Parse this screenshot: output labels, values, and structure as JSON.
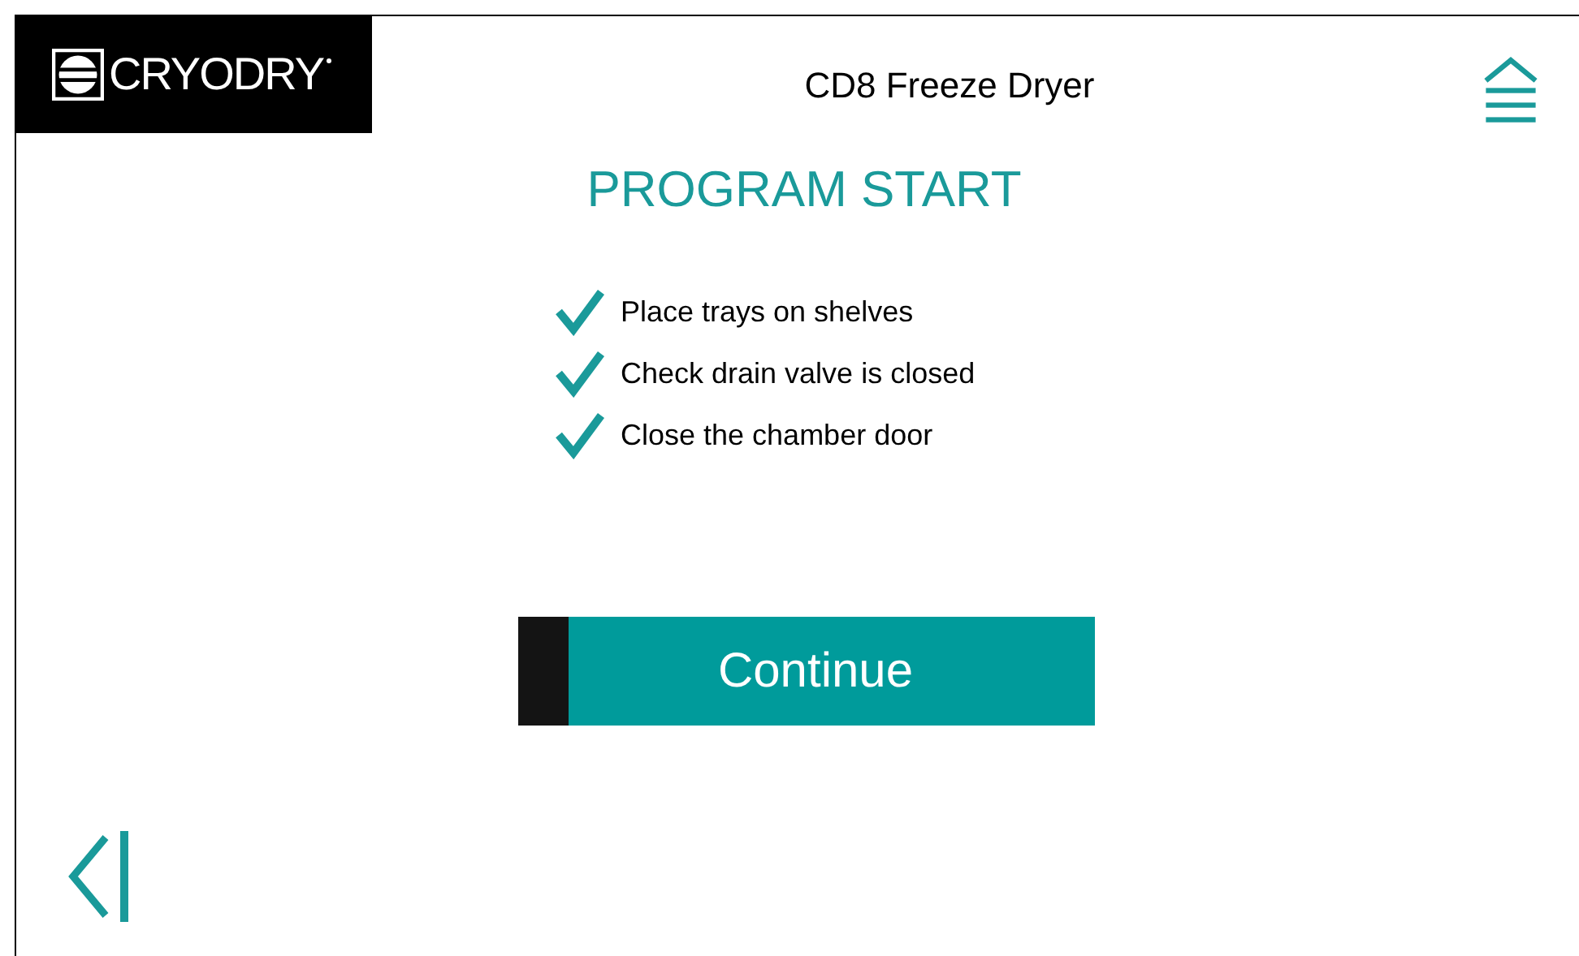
{
  "logo": {
    "text": "CRYODRY"
  },
  "header": {
    "title": "CD8 Freeze Dryer"
  },
  "heading": "PROGRAM START",
  "checklist": [
    {
      "label": "Place trays on shelves",
      "checked": true
    },
    {
      "label": "Check drain valve is closed",
      "checked": true
    },
    {
      "label": "Close the chamber door",
      "checked": true
    }
  ],
  "continue_button": "Continue"
}
